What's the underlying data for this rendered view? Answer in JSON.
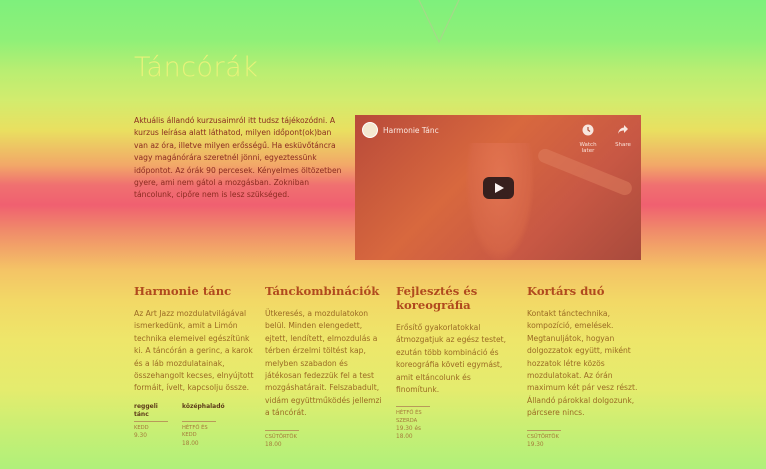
{
  "page": {
    "title": "Táncórák",
    "intro": "Aktuális állandó kurzusaimról itt tudsz tájékozódni. A kurzus leírása alatt láthatod, milyen időpont(ok)ban van az óra, illetve milyen erősségű. Ha esküvőtáncra vagy magánórára szeretnél jönni, egyeztessünk időpontot. Az órák 90 percesek. Kényelmes öltözetben gyere, ami nem gátol a mozgásban. Zokniban táncolunk, cipőre nem is lesz szükséged."
  },
  "video": {
    "channel_title": "Harmonie Tánc",
    "watch_later_label": "Watch later",
    "share_label": "Share",
    "icons": [
      "clock-icon",
      "share-icon",
      "play-icon"
    ]
  },
  "courses": [
    {
      "title": "Harmonie tánc",
      "description": "Az Art Jazz mozdulatvilágával ismerkedünk, amit a Limón technika elemeivel egészítünk ki. A táncórán a gerinc, a karok és a láb mozdulatainak, összehangolt kecses, elnyújtott formáit, ívelt, kapcsolju össze.",
      "sessions": [
        {
          "level": "reggeli tánc",
          "day": "kedd",
          "time": "9.30"
        },
        {
          "level": "középhaladó",
          "day": "hétfő és kedd",
          "time": "18.00"
        }
      ]
    },
    {
      "title": "Tánckombinációk",
      "description": "Ütkeresés, a mozdulatokon belül. Minden elengedett, ejtett, lendített, elmozdulás a térben érzelmi töltést kap, melyben szabadon és játékosan fedezzük fel a test mozgáshatárait. Felszabadult, vidám együttműködés jellemzi a táncórát.",
      "sessions": [
        {
          "level": "",
          "day": "csütörtök",
          "time": "18.00"
        }
      ]
    },
    {
      "title": "Fejlesztés és koreográfia",
      "description": "Erősítő gyakorlatokkal átmozgatjuk az egész testet, ezután több kombináció és koreográfia követi egymást, amit eltáncolunk és finomítunk.",
      "sessions": [
        {
          "level": "",
          "day": "hétfő és szerda",
          "time": "19.30 és 18.00"
        }
      ]
    },
    {
      "title": "Kortárs duó",
      "description": "Kontakt tánctechnika, kompozíció, emelések. Megtanuljátok, hogyan dolgozzatok együtt, miként hozzatok létre közös mozdulatokat. Az órán maximum két pár vesz részt. Állandó párokkal dolgozunk, párcsere nincs.",
      "sessions": [
        {
          "level": "",
          "day": "csütörtök",
          "time": "19.30"
        }
      ]
    }
  ]
}
